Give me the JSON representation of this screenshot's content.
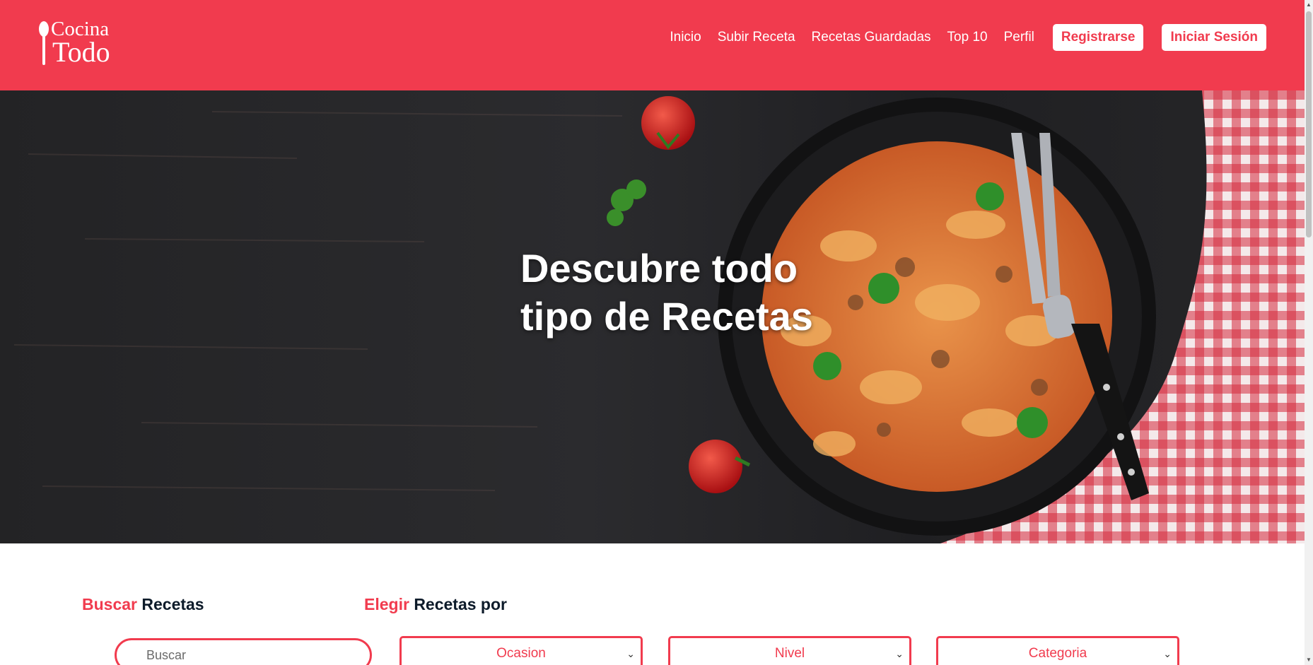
{
  "header": {
    "logo": {
      "line1": "Cocina",
      "line2": "Todo"
    },
    "nav": [
      "Inicio",
      "Subir Receta",
      "Recetas Guardadas",
      "Top 10",
      "Perfil"
    ],
    "register_label": "Registrarse",
    "login_label": "Iniciar Sesión"
  },
  "hero": {
    "title_line1": "Descubre todo",
    "title_line2": "tipo de Recetas"
  },
  "search": {
    "title_accent": "Buscar",
    "title_rest": "Recetas",
    "placeholder": "Buscar"
  },
  "filters": {
    "title_accent": "Elegir",
    "title_rest": "Recetas por",
    "selects": [
      "Ocasion",
      "Nivel",
      "Categoria"
    ]
  },
  "colors": {
    "brand": "#f13b4e",
    "text_dark": "#0d1b2a",
    "white": "#ffffff"
  },
  "icons": {
    "logo": "spoon-icon",
    "select": "chevron-down-icon"
  }
}
